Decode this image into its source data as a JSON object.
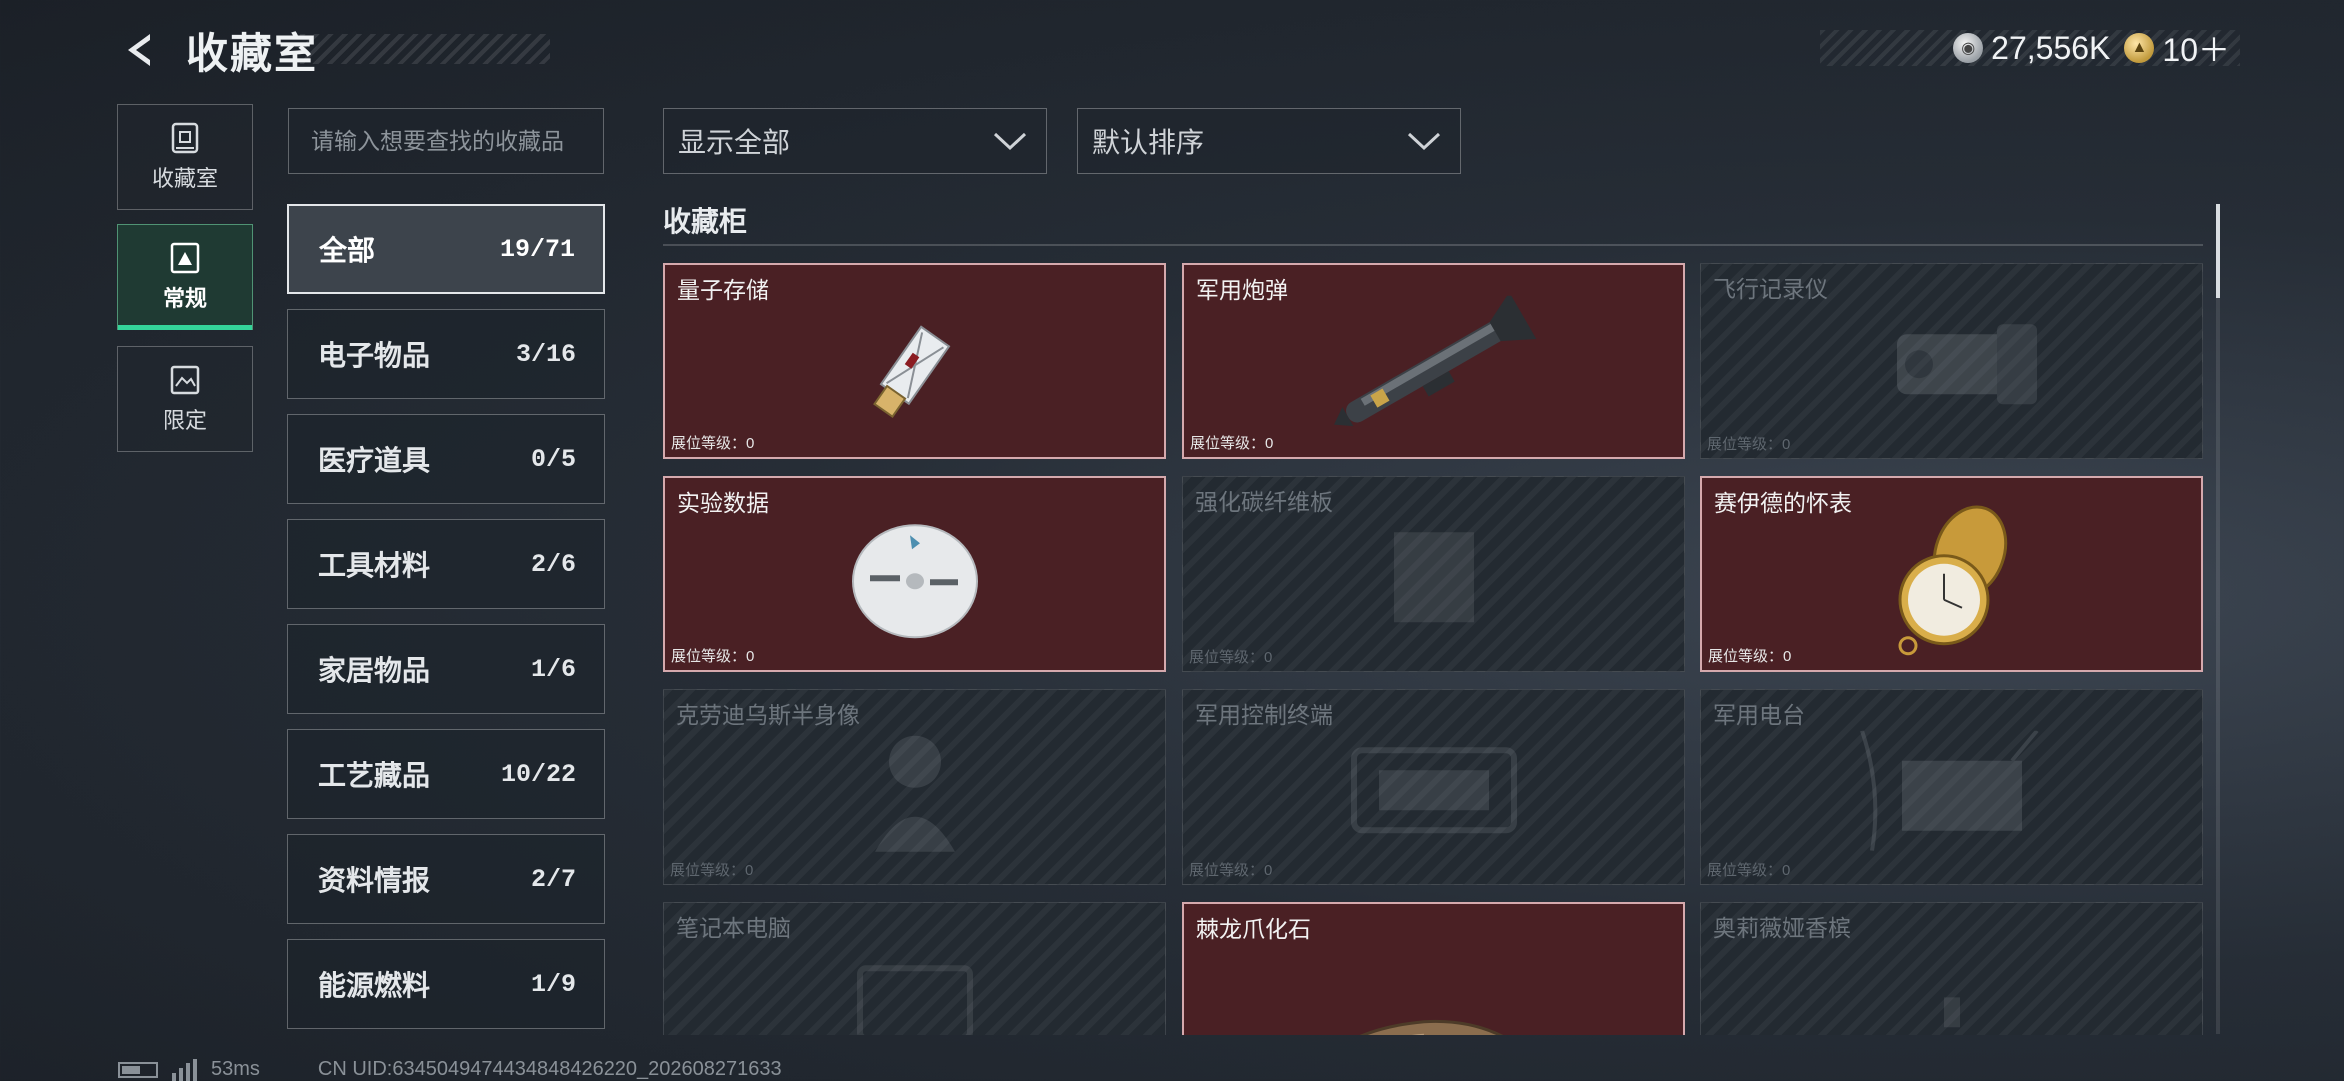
{
  "header": {
    "title": "收藏室",
    "currency_silver": "27,556K",
    "currency_gold": "10＋",
    "back_icon": "back-arrow-icon"
  },
  "side_tabs": [
    {
      "label": "收藏室",
      "icon": "collection-room-icon",
      "active": false
    },
    {
      "label": "常规",
      "icon": "regular-icon",
      "active": true
    },
    {
      "label": "限定",
      "icon": "limited-icon",
      "active": false
    }
  ],
  "search": {
    "placeholder": "请输入想要查找的收藏品"
  },
  "categories": [
    {
      "label": "全部",
      "count": "19/71",
      "active": true
    },
    {
      "label": "电子物品",
      "count": "3/16"
    },
    {
      "label": "医疗道具",
      "count": "0/5"
    },
    {
      "label": "工具材料",
      "count": "2/6"
    },
    {
      "label": "家居物品",
      "count": "1/6"
    },
    {
      "label": "工艺藏品",
      "count": "10/22"
    },
    {
      "label": "资料情报",
      "count": "2/7"
    },
    {
      "label": "能源燃料",
      "count": "1/9"
    }
  ],
  "filters": {
    "display": "显示全部",
    "sort": "默认排序"
  },
  "section": {
    "title": "收藏柜"
  },
  "cards": [
    {
      "name": "量子存储",
      "level": "展位等级：0",
      "owned": true,
      "icon": "usb-drive-icon"
    },
    {
      "name": "军用炮弹",
      "level": "展位等级：0",
      "owned": true,
      "icon": "missile-icon"
    },
    {
      "name": "飞行记录仪",
      "level": "展位等级：0",
      "owned": false,
      "icon": "flight-recorder-icon"
    },
    {
      "name": "实验数据",
      "level": "展位等级：0",
      "owned": true,
      "icon": "disc-icon"
    },
    {
      "name": "强化碳纤维板",
      "level": "展位等级：0",
      "owned": false,
      "icon": "carbon-plate-icon"
    },
    {
      "name": "赛伊德的怀表",
      "level": "展位等级：0",
      "owned": true,
      "icon": "pocket-watch-icon"
    },
    {
      "name": "克劳迪乌斯半身像",
      "level": "展位等级：0",
      "owned": false,
      "icon": "bust-icon"
    },
    {
      "name": "军用控制终端",
      "level": "展位等级：0",
      "owned": false,
      "icon": "terminal-icon"
    },
    {
      "name": "军用电台",
      "level": "展位等级：0",
      "owned": false,
      "icon": "radio-icon"
    },
    {
      "name": "笔记本电脑",
      "level": "",
      "owned": false,
      "icon": "laptop-icon"
    },
    {
      "name": "棘龙爪化石",
      "level": "",
      "owned": true,
      "icon": "claw-fossil-icon"
    },
    {
      "name": "奥莉薇娅香槟",
      "level": "",
      "owned": false,
      "icon": "champagne-icon"
    }
  ],
  "status": {
    "ping": "53ms",
    "uid": "CN UID:6345049474434848426220_202608271633"
  }
}
